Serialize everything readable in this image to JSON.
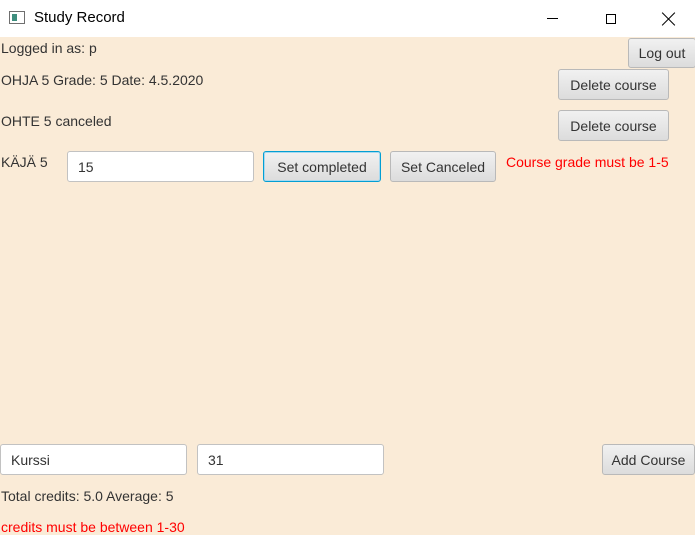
{
  "window": {
    "title": "Study Record",
    "minimize_glyph": "",
    "maximize_glyph": "",
    "close_glyph": ""
  },
  "session": {
    "logged_in_text": "Logged in as: p",
    "logout_label": "Log out"
  },
  "courses": [
    {
      "text": "OHJA 5 Grade: 5 Date: 4.5.2020",
      "delete_label": "Delete course"
    },
    {
      "text": "OHTE 5 canceled",
      "delete_label": "Delete course"
    }
  ],
  "pending_course": {
    "label": "KÄJÄ 5",
    "grade_value": "15",
    "set_completed_label": "Set completed",
    "set_canceled_label": "Set Canceled",
    "error": "Course grade must be 1-5"
  },
  "add_course": {
    "name_value": "Kurssi",
    "credits_value": "31",
    "add_label": "Add Course"
  },
  "summary": {
    "totals_text": "Total credits: 5.0 Average: 5",
    "error": "credits must be between 1-30"
  }
}
